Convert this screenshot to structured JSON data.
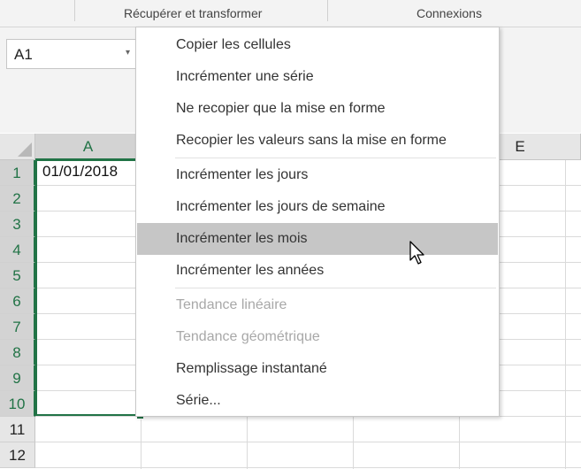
{
  "ribbon": {
    "groups": [
      "Récupérer et transformer",
      "Connexions"
    ]
  },
  "namebox": {
    "value": "A1",
    "arrow": "▾"
  },
  "sheet": {
    "columns": [
      "A",
      "E"
    ],
    "rows": [
      "1",
      "2",
      "3",
      "4",
      "5",
      "6",
      "7",
      "8",
      "9",
      "10",
      "11",
      "12"
    ],
    "cell_a1": "01/01/2018"
  },
  "menu": {
    "items": [
      {
        "label": "Copier les cellules",
        "state": "normal"
      },
      {
        "label": "Incrémenter une série",
        "state": "normal"
      },
      {
        "label": "Ne recopier que la mise en forme",
        "state": "normal"
      },
      {
        "label": "Recopier les valeurs sans la mise en forme",
        "state": "normal"
      },
      {
        "label": "Incrémenter les jours",
        "state": "normal"
      },
      {
        "label": "Incrémenter les jours de semaine",
        "state": "normal"
      },
      {
        "label": "Incrémenter les mois",
        "state": "highlighted"
      },
      {
        "label": "Incrémenter les années",
        "state": "normal"
      },
      {
        "label": "Tendance linéaire",
        "state": "disabled"
      },
      {
        "label": "Tendance géométrique",
        "state": "disabled"
      },
      {
        "label": "Remplissage instantané",
        "state": "normal"
      },
      {
        "label": "Série...",
        "state": "normal"
      }
    ]
  },
  "colors": {
    "accent": "#217346",
    "highlight": "#c6c6c6"
  }
}
